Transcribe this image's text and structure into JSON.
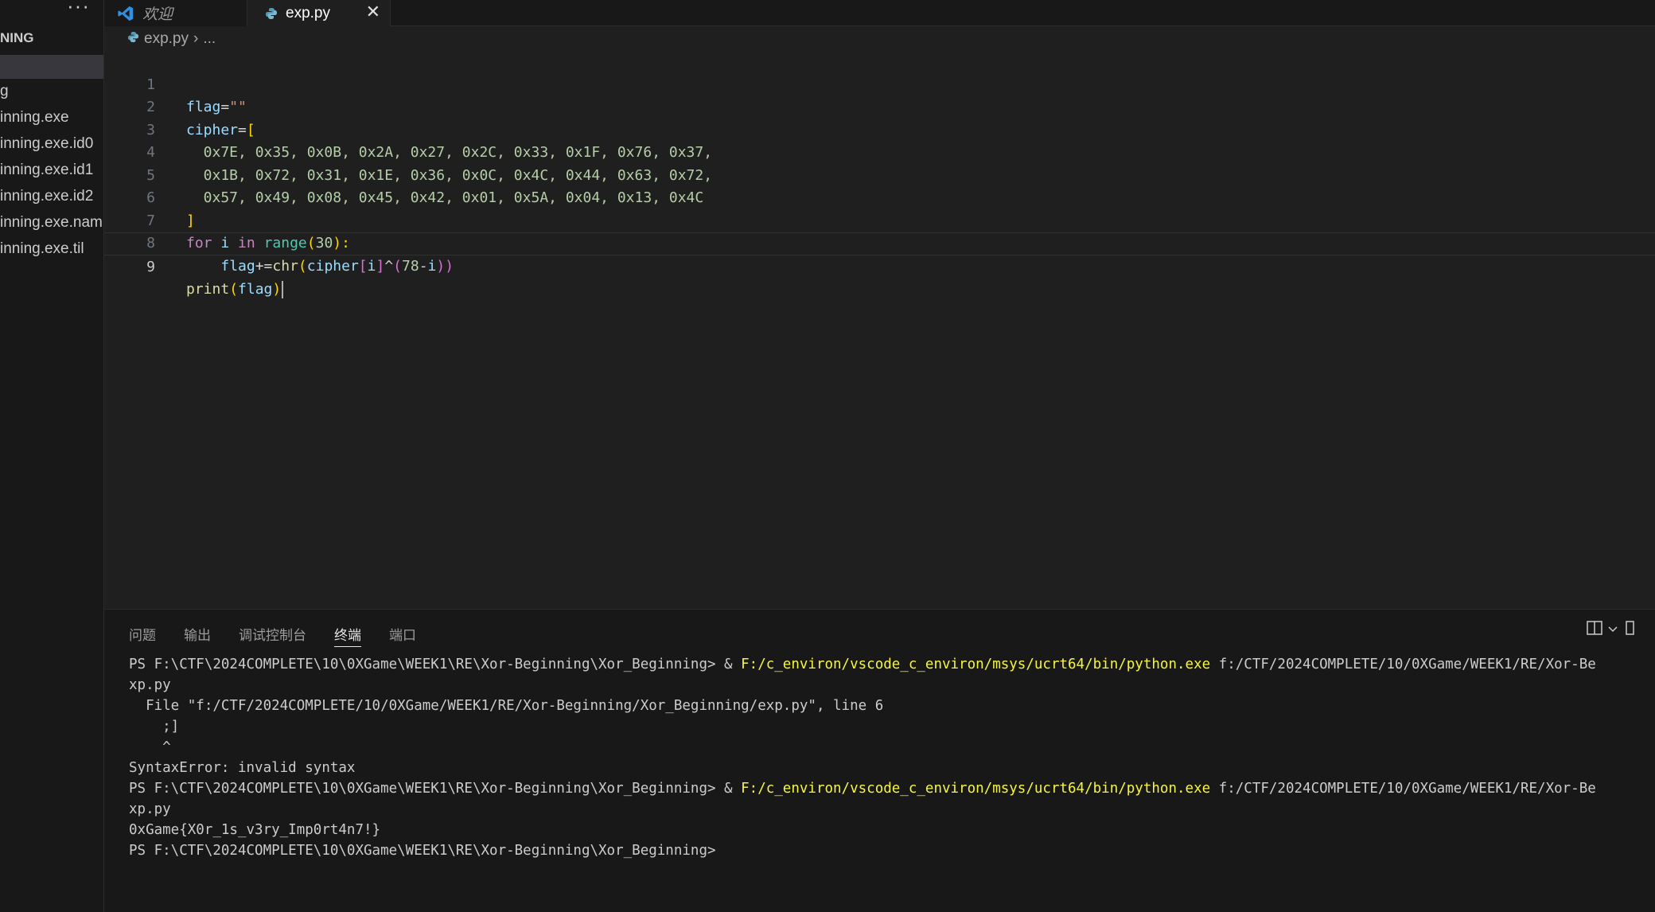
{
  "sidebar": {
    "more": "···",
    "folder_label": "NING",
    "items": [
      {
        "label": "g"
      },
      {
        "label": "inning.exe"
      },
      {
        "label": "inning.exe.id0"
      },
      {
        "label": "inning.exe.id1"
      },
      {
        "label": "inning.exe.id2"
      },
      {
        "label": "inning.exe.nam"
      },
      {
        "label": "inning.exe.til"
      }
    ]
  },
  "tabs": [
    {
      "label": "欢迎",
      "icon": "vscode-logo-icon"
    },
    {
      "label": "exp.py",
      "icon": "python-file-icon",
      "close": "✕"
    }
  ],
  "breadcrumb": {
    "file": "exp.py",
    "sep": "›",
    "more": "..."
  },
  "editor": {
    "line_numbers": [
      "1",
      "2",
      "3",
      "4",
      "5",
      "6",
      "7",
      "8",
      "9"
    ],
    "lines": [
      {
        "p": [
          "flag",
          "=",
          "\"\""
        ]
      },
      {
        "p": [
          "cipher",
          "=",
          "["
        ]
      },
      {
        "p": [
          "  0x7E, 0x35, 0x0B, 0x2A, 0x27, 0x2C, 0x33, 0x1F, 0x76, 0x37,"
        ]
      },
      {
        "p": [
          "  0x1B, 0x72, 0x31, 0x1E, 0x36, 0x0C, 0x4C, 0x44, 0x63, 0x72,"
        ]
      },
      {
        "p": [
          "  0x57, 0x49, 0x08, 0x45, 0x42, 0x01, 0x5A, 0x04, 0x13, 0x4C"
        ]
      },
      {
        "p": [
          "]"
        ]
      },
      {
        "p": [
          "for",
          " ",
          "i",
          " ",
          "in",
          " ",
          "range",
          "(",
          "30",
          "):"
        ]
      },
      {
        "p": [
          "    ",
          "flag",
          "+=",
          "chr",
          "(",
          "cipher",
          "[",
          "i",
          "]",
          "^",
          "(",
          "78",
          "-",
          "i",
          "))"
        ]
      },
      {
        "p": [
          "print",
          "(",
          "flag",
          ")"
        ]
      }
    ]
  },
  "panel": {
    "tabs": [
      "问题",
      "输出",
      "调试控制台",
      "终端",
      "端口"
    ],
    "active_tab": "终端",
    "terminal": [
      {
        "pre": "PS F:\\CTF\\2024COMPLETE\\10\\0XGame\\WEEK1\\RE\\Xor-Beginning\\Xor_Beginning> & ",
        "hl": "F:/c_environ/vscode_c_environ/msys/ucrt64/bin/python.exe",
        "post": " f:/CTF/2024COMPLETE/10/0XGame/WEEK1/RE/Xor-Be"
      },
      {
        "pre": "xp.py",
        "hl": "",
        "post": ""
      },
      {
        "pre": "  File \"f:/CTF/2024COMPLETE/10/0XGame/WEEK1/RE/Xor-Beginning/Xor_Beginning/exp.py\", line 6",
        "hl": "",
        "post": ""
      },
      {
        "pre": "    ;]",
        "hl": "",
        "post": ""
      },
      {
        "pre": "    ^",
        "hl": "",
        "post": ""
      },
      {
        "pre": "SyntaxError: invalid syntax",
        "hl": "",
        "post": ""
      },
      {
        "pre": "PS F:\\CTF\\2024COMPLETE\\10\\0XGame\\WEEK1\\RE\\Xor-Beginning\\Xor_Beginning> & ",
        "hl": "F:/c_environ/vscode_c_environ/msys/ucrt64/bin/python.exe",
        "post": " f:/CTF/2024COMPLETE/10/0XGame/WEEK1/RE/Xor-Be"
      },
      {
        "pre": "xp.py",
        "hl": "",
        "post": ""
      },
      {
        "pre": "0xGame{X0r_1s_v3ry_Imp0rt4n7!}",
        "hl": "",
        "post": ""
      },
      {
        "pre": "PS F:\\CTF\\2024COMPLETE\\10\\0XGame\\WEEK1\\RE\\Xor-Beginning\\Xor_Beginning>",
        "hl": "",
        "post": ""
      }
    ]
  }
}
